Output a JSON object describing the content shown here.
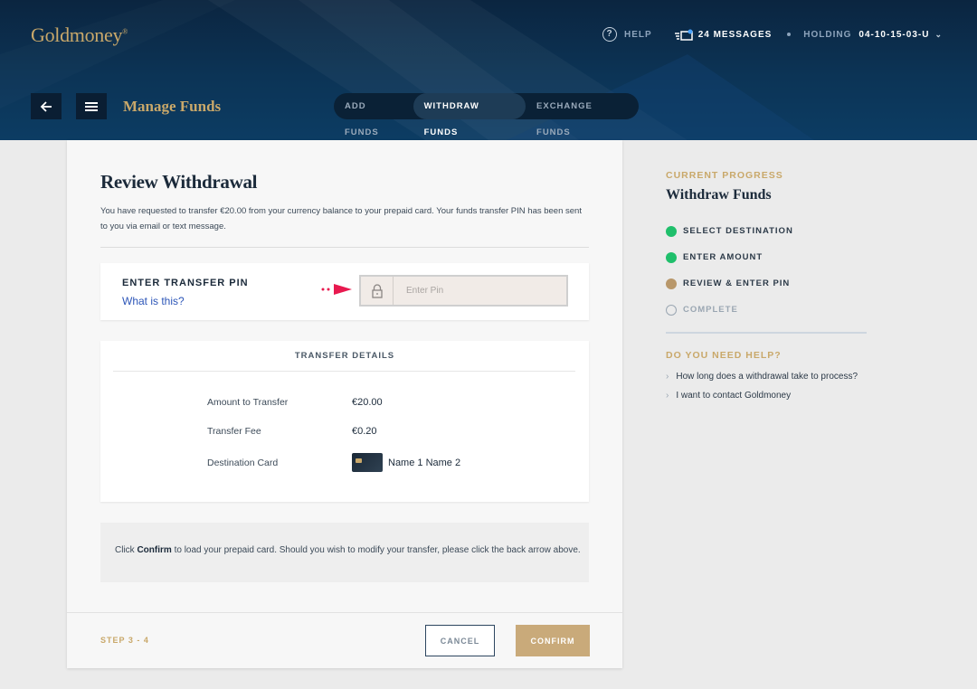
{
  "header": {
    "logo": "Goldmoney",
    "help_label": "HELP",
    "messages_label": "24 MESSAGES",
    "holding_label": "HOLDING",
    "holding_id": "04-10-15-03-U",
    "page_title": "Manage Funds",
    "tabs": [
      {
        "label": "ADD FUNDS",
        "active": false
      },
      {
        "label": "WITHDRAW FUNDS",
        "active": true
      },
      {
        "label": "EXCHANGE FUNDS",
        "active": false
      }
    ]
  },
  "review": {
    "title": "Review Withdrawal",
    "description": "You have requested to transfer €20.00 from your currency balance to your prepaid card. Your funds transfer PIN has been sent to you via email or text message.",
    "pin_label": "ENTER TRANSFER PIN",
    "pin_link": "What is this?",
    "pin_placeholder": "Enter Pin"
  },
  "transfer_details": {
    "title": "TRANSFER DETAILS",
    "rows": [
      {
        "label": "Amount to Transfer",
        "value": "€20.00"
      },
      {
        "label": "Transfer Fee",
        "value": "€0.20"
      },
      {
        "label": "Destination Card",
        "value": "Name 1 Name 2"
      }
    ]
  },
  "note": {
    "prefix": "Click ",
    "bold": "Confirm",
    "suffix": " to load your prepaid card. Should you wish to modify your transfer, please click the back arrow above."
  },
  "footer": {
    "step": "STEP 3 - 4",
    "cancel_label": "CANCEL",
    "confirm_label": "CONFIRM"
  },
  "sidebar": {
    "kicker": "CURRENT PROGRESS",
    "title": "Withdraw Funds",
    "steps": [
      {
        "label": "SELECT DESTINATION",
        "status": "done"
      },
      {
        "label": "ENTER AMOUNT",
        "status": "done"
      },
      {
        "label": "REVIEW & ENTER PIN",
        "status": "current"
      },
      {
        "label": "COMPLETE",
        "status": "pending"
      }
    ],
    "help_title": "DO YOU NEED HELP?",
    "help_links": [
      "How long does a withdrawal take to process?",
      "I want to contact Goldmoney"
    ]
  },
  "colors": {
    "gold": "#c9a86a",
    "navy": "#0b2540",
    "done": "#1fbf6b",
    "current": "#b8976a"
  }
}
